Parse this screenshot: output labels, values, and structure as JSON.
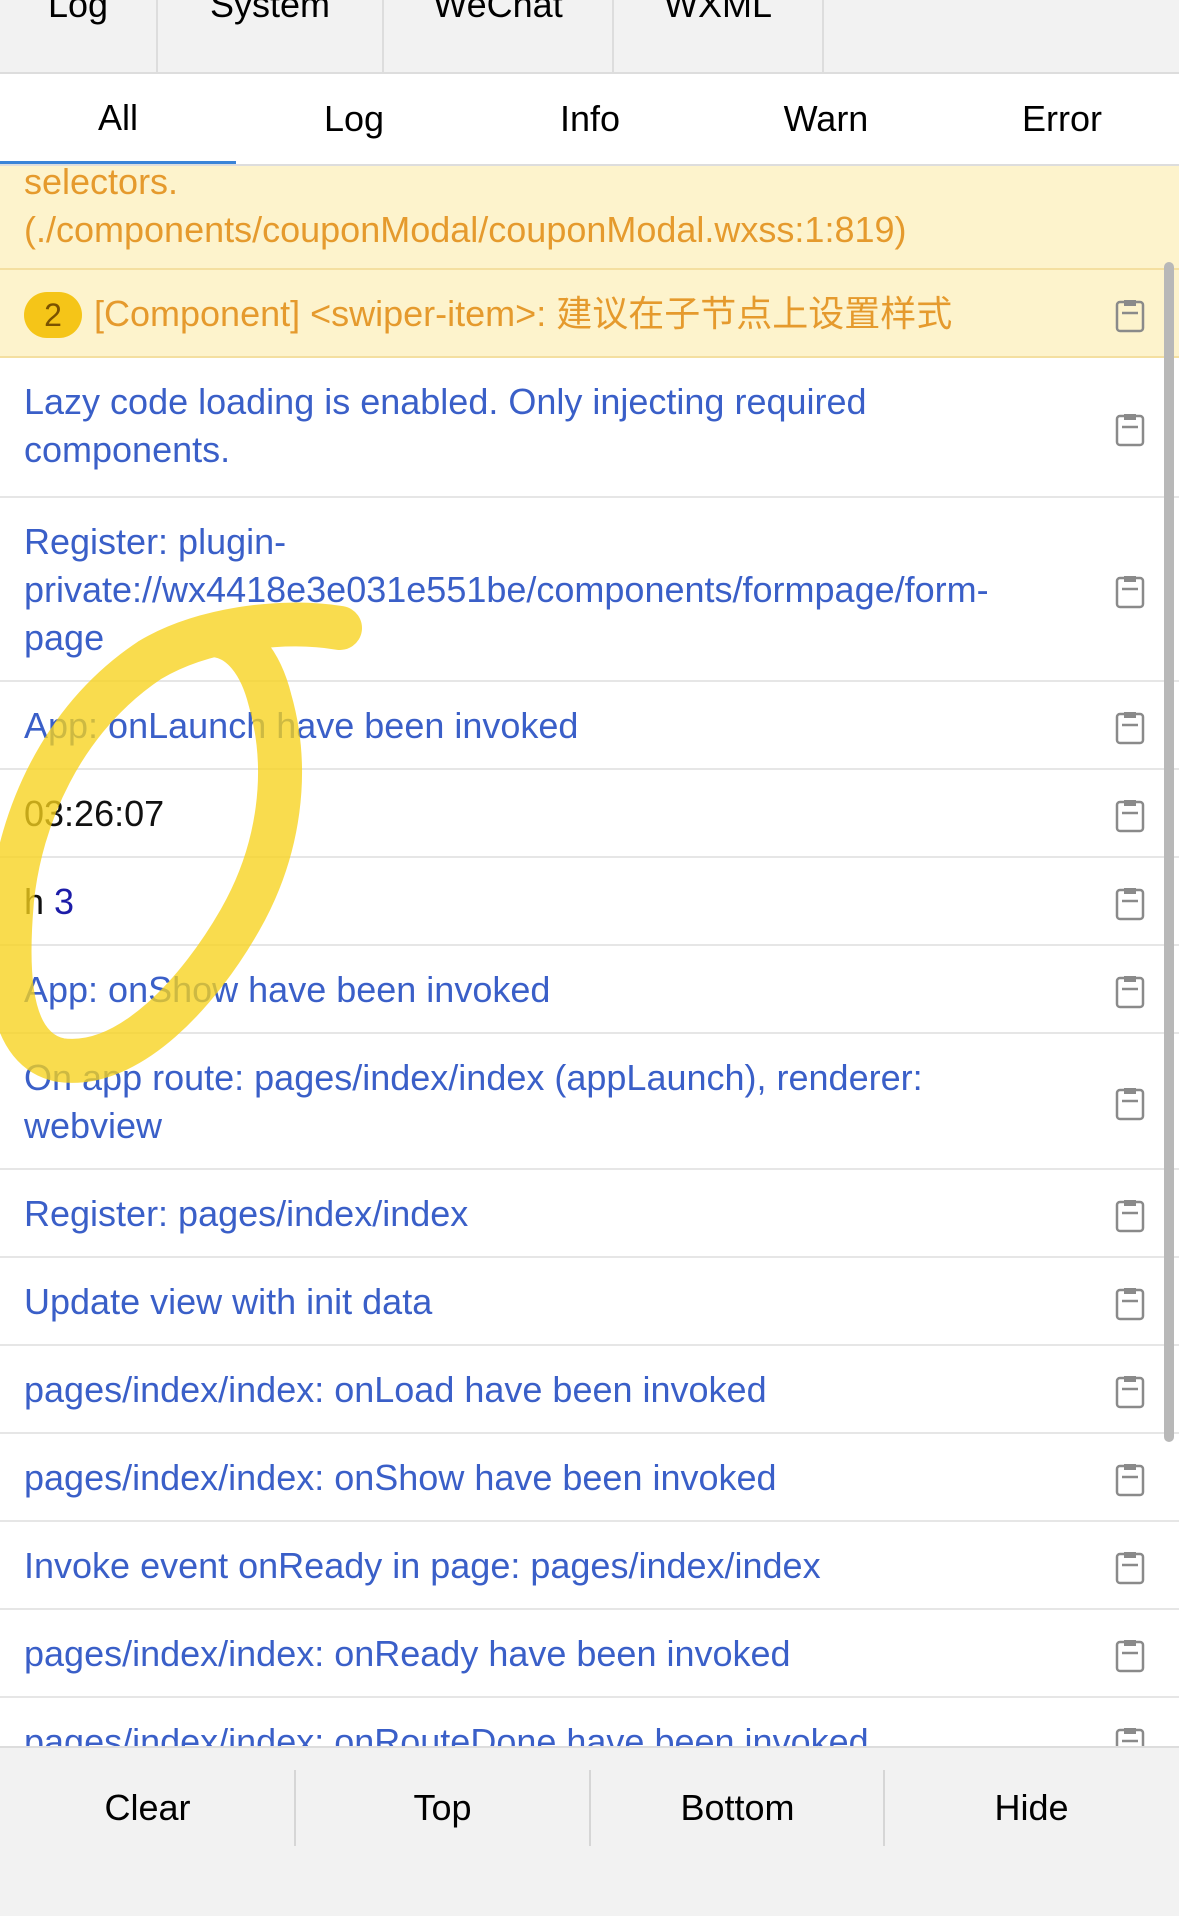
{
  "outer_tabs": [
    "Log",
    "System",
    "WeChat",
    "WXML"
  ],
  "filter_tabs": [
    "All",
    "Log",
    "Info",
    "Warn",
    "Error"
  ],
  "active_filter": "All",
  "entries": [
    {
      "type": "warn",
      "lines": [
        "selectors.",
        "(./components/couponModal/couponModal.wxss:1:819)"
      ],
      "copy": false
    },
    {
      "type": "warn",
      "badge": "2",
      "lines": [
        "[Component] <swiper-item>: 建议在子节点上设置样式"
      ],
      "copy": true
    },
    {
      "type": "info",
      "lines": [
        "Lazy code loading is enabled. Only injecting required",
        "components."
      ],
      "copy": true
    },
    {
      "type": "info",
      "lines": [
        "Register: plugin-",
        "private://wx4418e3e031e551be/components/formpage/form-",
        "page"
      ],
      "copy": true
    },
    {
      "type": "info",
      "lines": [
        "App: onLaunch have been invoked"
      ],
      "copy": true
    },
    {
      "type": "log",
      "lines": [
        "03:26:07"
      ],
      "copy": true
    },
    {
      "type": "log",
      "prefix": "h",
      "number": "3",
      "copy": true
    },
    {
      "type": "info",
      "lines": [
        "App: onShow have been invoked"
      ],
      "copy": true
    },
    {
      "type": "info",
      "lines": [
        "On app route: pages/index/index (appLaunch), renderer:",
        "webview"
      ],
      "copy": true
    },
    {
      "type": "info",
      "lines": [
        "Register: pages/index/index"
      ],
      "copy": true
    },
    {
      "type": "info",
      "lines": [
        "Update view with init data"
      ],
      "copy": true
    },
    {
      "type": "info",
      "lines": [
        "pages/index/index: onLoad have been invoked"
      ],
      "copy": true
    },
    {
      "type": "info",
      "lines": [
        "pages/index/index: onShow have been invoked"
      ],
      "copy": true
    },
    {
      "type": "info",
      "lines": [
        "Invoke event onReady in page: pages/index/index"
      ],
      "copy": true
    },
    {
      "type": "info",
      "lines": [
        "pages/index/index: onReady have been invoked"
      ],
      "copy": true
    },
    {
      "type": "info",
      "lines": [
        "pages/index/index: onRouteDone have been invoked"
      ],
      "copy": true
    }
  ],
  "bottom_buttons": [
    "Clear",
    "Top",
    "Bottom",
    "Hide"
  ],
  "icons": {
    "copy": "clipboard-icon"
  },
  "colors": {
    "info_text": "#3a5fc8",
    "warn_text": "#e59a2d",
    "warn_bg": "#fdf3cc",
    "badge": "#f5c518",
    "active_tab_underline": "#3a84d8",
    "highlighter": "#f7d21c"
  }
}
